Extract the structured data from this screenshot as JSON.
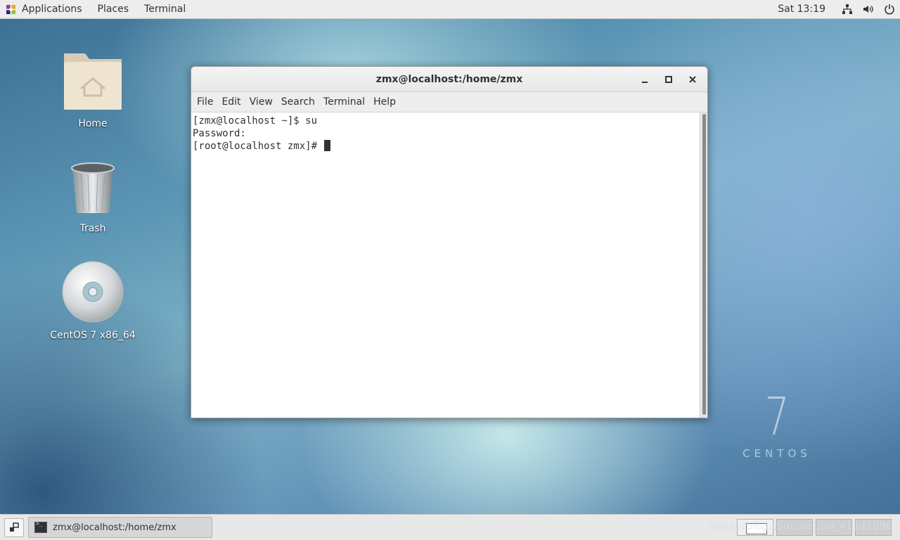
{
  "top_bar": {
    "menus": [
      "Applications",
      "Places",
      "Terminal"
    ],
    "clock": "Sat 13:19",
    "tray_icons": [
      "network-icon",
      "volume-icon",
      "power-icon"
    ]
  },
  "desktop": {
    "icons": [
      {
        "label": "Home",
        "icon": "home-folder-icon"
      },
      {
        "label": "Trash",
        "icon": "trash-icon"
      },
      {
        "label": "CentOS 7 x86_64",
        "icon": "optical-disc-icon"
      }
    ],
    "brand_number": "7",
    "brand_word": "CENTOS"
  },
  "terminal_window": {
    "title": "zmx@localhost:/home/zmx",
    "menus": [
      "File",
      "Edit",
      "View",
      "Search",
      "Terminal",
      "Help"
    ],
    "lines": [
      "[zmx@localhost ~]$ su",
      "Password:",
      "[root@localhost zmx]# "
    ]
  },
  "taskbar": {
    "items": [
      {
        "label": "zmx@localhost:/home/zmx",
        "icon": "terminal-icon"
      }
    ],
    "workspaces": 4,
    "active_workspace": 1
  },
  "watermark": "https://blog.csdn.net/qq_41141996",
  "colors": {
    "panel_bg": "#ededed",
    "text": "#2e3436",
    "terminal_bg": "#ffffff"
  }
}
